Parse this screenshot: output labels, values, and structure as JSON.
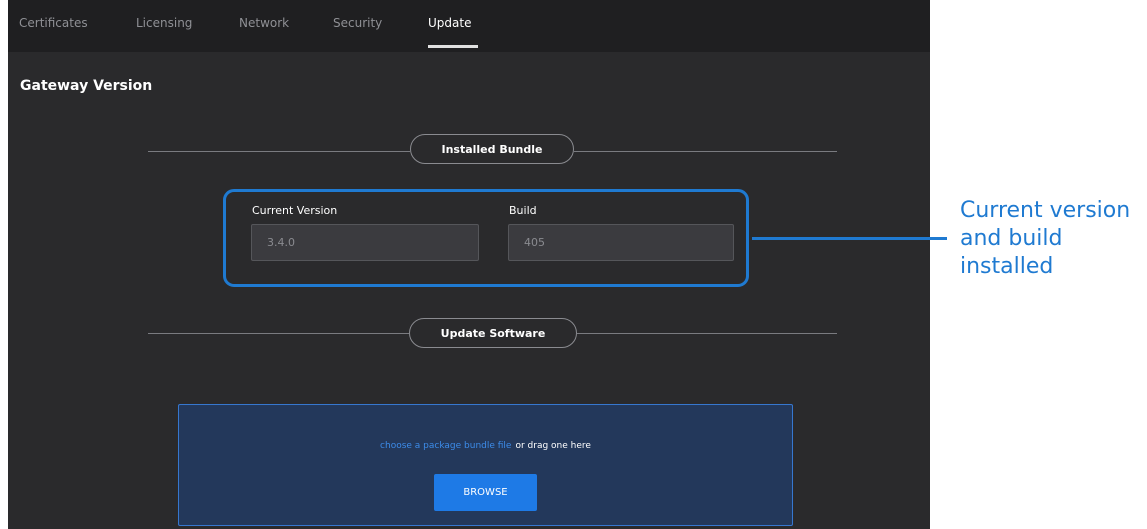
{
  "tabs": [
    {
      "label": "Certificates",
      "active": false
    },
    {
      "label": "Licensing",
      "active": false
    },
    {
      "label": "Network",
      "active": false
    },
    {
      "label": "Security",
      "active": false
    },
    {
      "label": "Update",
      "active": true
    }
  ],
  "section_title": "Gateway Version",
  "installed_bundle": {
    "title": "Installed Bundle",
    "current_version": {
      "label": "Current Version",
      "value": "3.4.0"
    },
    "build": {
      "label": "Build",
      "value": "405"
    }
  },
  "update_software": {
    "title": "Update Software",
    "dropzone": {
      "link_text": "choose a package bundle file",
      "text": "or drag one here",
      "browse_label": "BROWSE"
    }
  },
  "callout": {
    "lines": [
      "Current version",
      "and build",
      "installed"
    ]
  },
  "colors": {
    "accent": "#1f7ad1",
    "button": "#1e7ae6",
    "panel_bg": "#2a2a2c",
    "dropzone_bg": "#23385b"
  }
}
